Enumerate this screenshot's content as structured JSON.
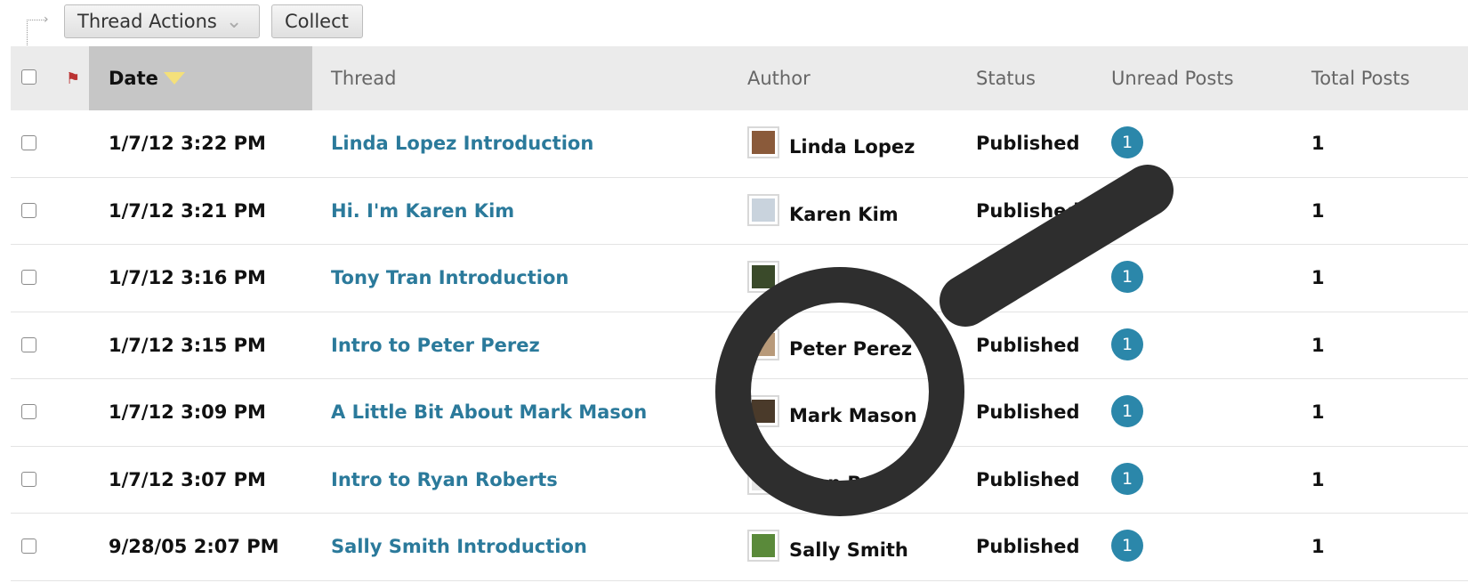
{
  "toolbar": {
    "thread_actions_label": "Thread Actions",
    "collect_label": "Collect"
  },
  "columns": {
    "date": "Date",
    "thread": "Thread",
    "author": "Author",
    "status": "Status",
    "unread": "Unread Posts",
    "total": "Total Posts"
  },
  "rows": [
    {
      "date": "1/7/12 3:22 PM",
      "thread": "Linda Lopez Introduction",
      "author": "Linda Lopez",
      "status": "Published",
      "unread": "1",
      "total": "1"
    },
    {
      "date": "1/7/12 3:21 PM",
      "thread": "Hi. I'm Karen Kim",
      "author": "Karen Kim",
      "status": "Published",
      "unread": "",
      "total": "1"
    },
    {
      "date": "1/7/12 3:16 PM",
      "thread": "Tony Tran Introduction",
      "author": "",
      "status": "",
      "unread": "1",
      "total": "1"
    },
    {
      "date": "1/7/12 3:15 PM",
      "thread": "Intro to Peter Perez",
      "author": "Peter Perez",
      "status": "Published",
      "unread": "1",
      "total": "1"
    },
    {
      "date": "1/7/12 3:09 PM",
      "thread": "A Little Bit About Mark Mason",
      "author": "Mark Mason",
      "status": "Published",
      "unread": "1",
      "total": "1"
    },
    {
      "date": "1/7/12 3:07 PM",
      "thread": "Intro to Ryan Roberts",
      "author": "Ryan Robe",
      "status": "Published",
      "unread": "1",
      "total": "1"
    },
    {
      "date": "9/28/05 2:07 PM",
      "thread": "Sally Smith Introduction",
      "author": "Sally Smith",
      "status": "Published",
      "unread": "1",
      "total": "1"
    }
  ],
  "colors": {
    "link": "#2b7a9b",
    "badge": "#2b87aa",
    "header_bg": "#ebebeb",
    "sorted_header_bg": "#c6c6c6"
  },
  "icons": {
    "sort": "triangle-down-icon",
    "flag": "flag-icon",
    "magnifier": "magnifying-glass-icon"
  }
}
